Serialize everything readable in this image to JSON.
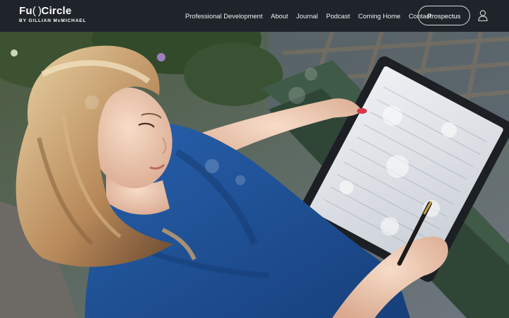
{
  "header": {
    "logo_prefix": "Fu",
    "logo_parens": "( )",
    "logo_suffix": "Circle",
    "logo_tagline": "BY GILLIAN McMICHAEL",
    "nav": [
      {
        "label": "Professional Development"
      },
      {
        "label": "About"
      },
      {
        "label": "Journal"
      },
      {
        "label": "Podcast"
      },
      {
        "label": "Coming Home"
      },
      {
        "label": "Contact"
      }
    ],
    "cta_label": "Prospectus",
    "user_icon": "user-icon"
  },
  "hero": {
    "image": "woman-writing-on-tablet-photo"
  },
  "colors": {
    "nav_background": "#1f242b",
    "nav_text": "#f0f0f0",
    "shirt_blue": "#1e4e93"
  }
}
